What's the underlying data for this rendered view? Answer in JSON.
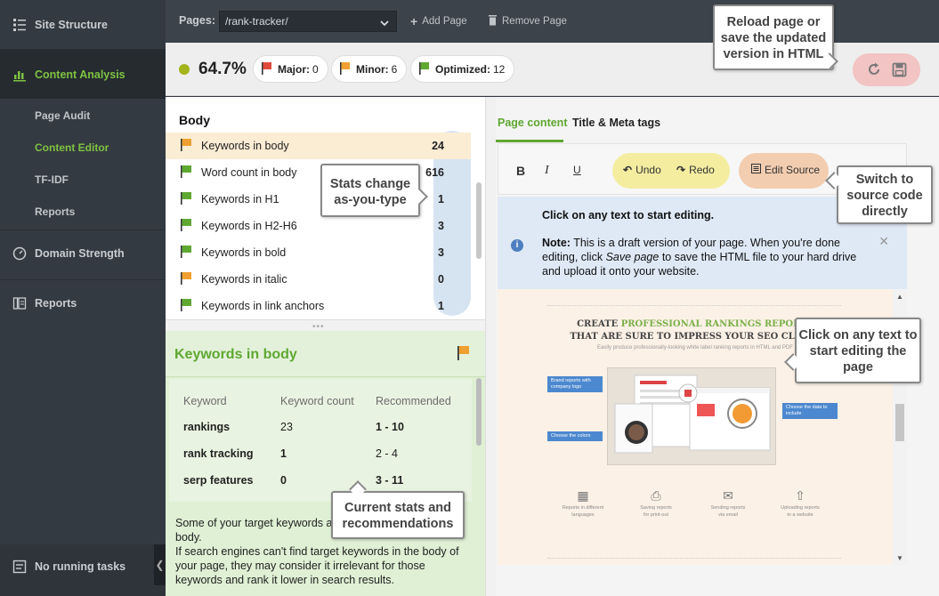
{
  "sidebar": {
    "site_structure": "Site Structure",
    "content_analysis": "Content Analysis",
    "sub": [
      "Page Audit",
      "Content Editor",
      "TF-IDF",
      "Reports"
    ],
    "domain_strength": "Domain Strength",
    "reports": "Reports",
    "tasks": "No running tasks",
    "active_color": "#7ec242"
  },
  "topbar": {
    "pages_label": "Pages:",
    "page_value": "/rank-tracker/",
    "add_page": "Add Page",
    "remove_page": "Remove Page"
  },
  "summary": {
    "score": "64.7%",
    "major_label": "Major:",
    "major_count": "0",
    "minor_label": "Minor:",
    "minor_count": "6",
    "optimized_label": "Optimized:",
    "optimized_count": "12"
  },
  "body_panel": {
    "title": "Body",
    "rows": [
      {
        "label": "Keywords in body",
        "value": "24",
        "flag": "orange"
      },
      {
        "label": "Word count in body",
        "value": "616",
        "flag": "green"
      },
      {
        "label": "Keywords in H1",
        "value": "1",
        "flag": "green"
      },
      {
        "label": "Keywords in H2-H6",
        "value": "3",
        "flag": "green"
      },
      {
        "label": "Keywords in bold",
        "value": "3",
        "flag": "green"
      },
      {
        "label": "Keywords in italic",
        "value": "0",
        "flag": "orange"
      },
      {
        "label": "Keywords in link anchors",
        "value": "1",
        "flag": "green"
      }
    ]
  },
  "detail": {
    "title": "Keywords in body",
    "headers": [
      "Keyword",
      "Keyword count",
      "Recommended"
    ],
    "rows": [
      {
        "keyword": "rankings",
        "count": "23",
        "recommended": "1 - 10"
      },
      {
        "keyword": "rank tracking",
        "count": "1",
        "recommended": "2 - 4"
      },
      {
        "keyword": "serp features",
        "count": "0",
        "recommended": "3 - 11"
      }
    ],
    "text": "Some of your target keywords are missing from your page body.\nIf search engines can't find target keywords in the body of your page, they may consider it irrelevant for those keywords and rank it lower in search results."
  },
  "editor": {
    "tab_content": "Page content",
    "tab_meta": "Title & Meta tags",
    "bold": "B",
    "italic": "I",
    "underline": "U",
    "undo": "Undo",
    "redo": "Redo",
    "edit_source": "Edit Source",
    "info_title": "Click on any text to start editing.",
    "note_label": "Note:",
    "note_text_1": " This is a draft version of your page. When you're done editing, click ",
    "note_save": "Save page",
    "note_text_2": " to save the HTML file to your hard drive and upload it onto your website."
  },
  "preview": {
    "title_a": "CREATE ",
    "title_b": "PROFESSIONAL RANKINGS REPORTS",
    "title_c": "THAT ARE SURE TO IMPRESS YOUR SEO CLIENT",
    "subtitle": "Easily produce professionally-looking white label ranking reports in HTML and PDF",
    "tag_brand": "Brand reports with company logo",
    "tag_colors": "Choose the colors",
    "tag_data": "Choose the data to include",
    "features": [
      {
        "l1": "Reports in different",
        "l2": "languages"
      },
      {
        "l1": "Saving reports",
        "l2": "for print-out"
      },
      {
        "l1": "Sending reports",
        "l2": "via email"
      },
      {
        "l1": "Uploading reports",
        "l2": "to a website"
      }
    ]
  },
  "callouts": {
    "reload": "Reload page or save the updated version in HTML",
    "stats": "Stats change as-you-type",
    "source": "Switch to source code directly",
    "click": "Click on any text to start editing the page",
    "current": "Current stats and recommendations"
  },
  "colors": {
    "green": "#5fa832",
    "orange": "#f0a030",
    "red": "#e04a3a",
    "score_dot": "#a4b41c"
  }
}
